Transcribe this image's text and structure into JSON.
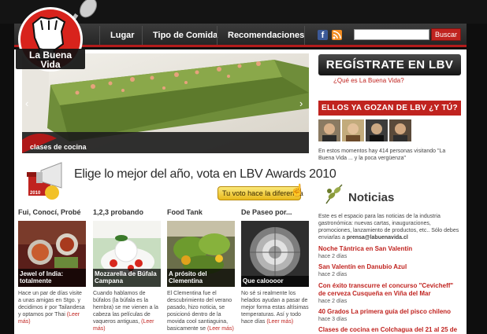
{
  "brand": {
    "name_line1": "La Buena",
    "name_line2": "Vida"
  },
  "nav": {
    "items": [
      {
        "label": "Lugar"
      },
      {
        "label": "Tipo de Comida"
      },
      {
        "label": "Recomendaciones"
      }
    ]
  },
  "search": {
    "button_label": "Buscar",
    "value": ""
  },
  "social": {
    "facebook": "facebook-icon",
    "rss": "rss-icon"
  },
  "slider": {
    "caption": "clases de cocina",
    "prev": "‹",
    "next": "›"
  },
  "awards": {
    "headline": "Elige lo mejor del año, vota en LBV Awards 2010",
    "badge_year": "2010",
    "vote_button": "Tu voto hace la diferencia"
  },
  "columns": [
    {
      "title": "Fui, Conocí, Probé",
      "caption_line1": "Jewel of India:",
      "caption_line2": "totalmente",
      "text": "Hace un par de días visite a unas amigas en Stgo. y decidimos ir por Tailandesa y optamos por Thai",
      "more": "(Leer más)"
    },
    {
      "title": "1,2,3 probando",
      "caption_line1": "Mozzarella de Búfala",
      "caption_line2": "Campana",
      "text": "Cuando hablamos de búfalos (la búfala es la hembra) se me vienen a la cabeza las películas de vaqueros antiguas,",
      "more": "(Leer más)"
    },
    {
      "title": "Food Tank",
      "caption_line1": "A prósito del",
      "caption_line2": "Clementina",
      "text": "El Clementina fue el descubrimiento del verano pasado, hizo noticia, se posicionó dentro de la movida cool santiaguina, basicamente se",
      "more": "(Leer más)"
    },
    {
      "title": "De Paseo por...",
      "caption_line1": "Que caloooor",
      "caption_line2": "",
      "text": "No sé si realmente los helados ayudan a pasar de mejor forma estas altísimas temperaturas. Así y todo hace días",
      "more": "(Leer más)"
    }
  ],
  "sidebar": {
    "register_button": "REGÍSTRATE EN LBV",
    "what_link": "¿Qué es La Buena Vida?",
    "gozan_heading": "ELLOS YA GOZAN DE LBV ¿Y TÚ?",
    "visitors_text": "En estos momentos hay 414 personas visitando \"La Buena Vida ... y la poca vergüenza\"",
    "noticias_title": "Noticias",
    "noticias_desc": "Este es el espacio para las noticias de la industria gastronómica: nuevas cartas, inauguraciones, promociones, lanzamiento de productos, etc.. Sólo debes enviarlas a",
    "noticias_email": "prensa@labuenavida.cl",
    "news": [
      {
        "title": "Noche Tántrica en San Valentín",
        "time": "hace 2 días"
      },
      {
        "title": "San Valentín en Danubio Azul",
        "time": "hace 2 días"
      },
      {
        "title": "Con éxito transcurre el concurso \"Cevicheff\" de cerveza Cusqueña en Viña del Mar",
        "time": "hace 2 días"
      },
      {
        "title": "40 Grados La primera guía del pisco chileno",
        "time": "hace 3 días"
      },
      {
        "title": "Clases de cocina en Colchagua del 21 al 25 de",
        "time": ""
      }
    ]
  },
  "colors": {
    "accent": "#c0231f",
    "nav_bg": "#2e2e2e",
    "page_bg": "#0e0e0e"
  }
}
